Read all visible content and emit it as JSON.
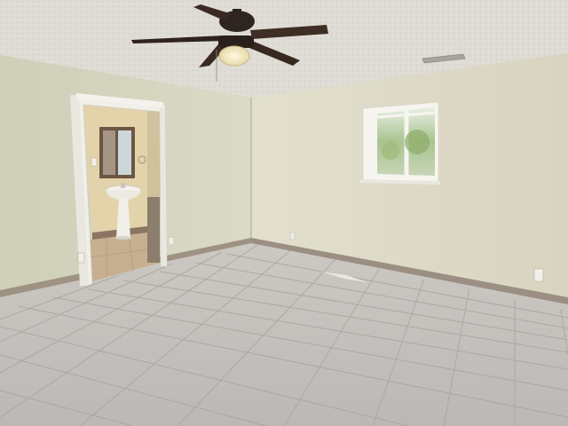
{
  "scene": {
    "description_type": "photo",
    "objects": [
      "textured-ceiling",
      "ceiling-fan",
      "fan-light",
      "air-vent",
      "left-wall",
      "back-wall",
      "window",
      "open-doorway",
      "bathroom",
      "pedestal-sink",
      "medicine-cabinet",
      "tile-floor",
      "baseboard",
      "wall-outlet"
    ]
  },
  "colors": {
    "ceiling": "#dcdad3",
    "wall_left": "#d3d3bc",
    "wall_back": "#dedbc8",
    "floor": "#c3bfbc",
    "grout": "#a8a39f",
    "baseboard": "#9a8f82",
    "fan_blade": "#3a2a22",
    "door_trim": "#f0efe8",
    "bathroom_wall": "#e4d6b0",
    "bathroom_floor": "#c9b294",
    "window_frame": "#f7f6f1",
    "window_glass": "#b9cfa9"
  }
}
